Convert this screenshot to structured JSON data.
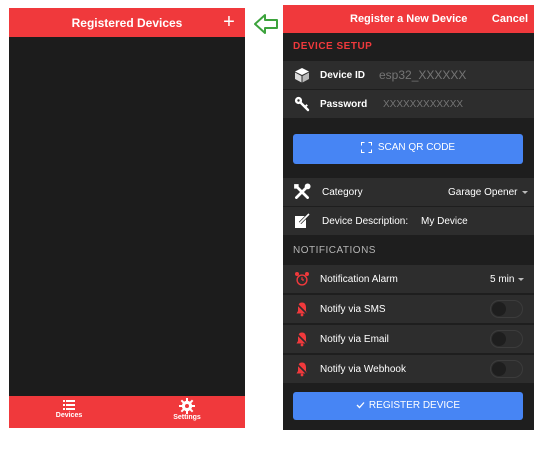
{
  "left_screen": {
    "header": {
      "title": "Registered Devices",
      "add_button": "+"
    },
    "footer": {
      "devices_label": "Devices",
      "settings_label": "Settings"
    }
  },
  "right_screen": {
    "header": {
      "title": "Register a New Device",
      "cancel_label": "Cancel"
    },
    "device_setup": {
      "section_title": "DEVICE SETUP",
      "device_id": {
        "label": "Device ID",
        "placeholder": "esp32_XXXXXX"
      },
      "password": {
        "label": "Password",
        "placeholder": "XXXXXXXXXXXX"
      },
      "scan_button": "SCAN QR CODE",
      "category": {
        "label": "Category",
        "value": "Garage Opener"
      },
      "description": {
        "label": "Device Description:",
        "value": "My Device"
      }
    },
    "notifications": {
      "section_title": "NOTIFICATIONS",
      "alarm": {
        "label": "Notification Alarm",
        "value": "5 min"
      },
      "sms": {
        "label": "Notify via SMS",
        "enabled": false
      },
      "email": {
        "label": "Notify via Email",
        "enabled": false
      },
      "webhook": {
        "label": "Notify via Webhook",
        "enabled": false
      }
    },
    "register_button": "REGISTER DEVICE"
  },
  "icons": {
    "menu": "list-icon",
    "settings": "gear-icon",
    "arrow": "arrow-left-icon",
    "device_id": "cube-icon",
    "password": "key-icon",
    "scan": "scan-frame-icon",
    "category": "tools-icon",
    "description": "edit-icon",
    "alarm": "alarm-clock-icon",
    "notify": "bell-off-icon",
    "check": "check-icon"
  },
  "colors": {
    "accent_red": "#f0393c",
    "button_blue": "#4785f4",
    "arrow_green": "#3ca33c",
    "dark_background": "#1e1e1e",
    "row_background": "#2d2d2d"
  }
}
